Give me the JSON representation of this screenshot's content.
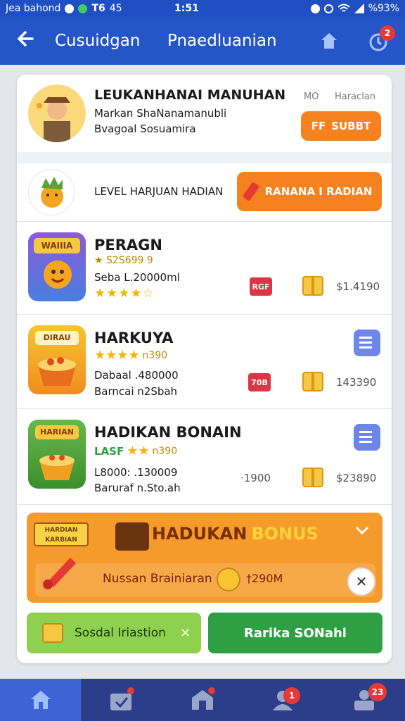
{
  "status_bar": {
    "left_text": "Jea bahond",
    "app_code": "T6",
    "extra": "45",
    "time": "1:51",
    "battery": "%93%"
  },
  "app_bar": {
    "title": "Cusuidgan",
    "subtitle": "Pnaedluanian",
    "notification_count": "2"
  },
  "profile": {
    "name": "LEUKANHANAI MANUHAN",
    "line1": "Markan ShaNanamanubli",
    "line2": "Bvagoal Sosuamira",
    "meta1": "MO",
    "meta2": "Haraclan",
    "button_prefix": "FF",
    "button_label": "SUBBT"
  },
  "level": {
    "label": "LEVEL HARJUAN HADIAN",
    "button_label": "RANANA I RADIAN"
  },
  "games": [
    {
      "title": "PERAGN",
      "thumb_label": "WAIIIA",
      "rating_text": "S2S699 9",
      "sub": "Seba L.20000ml",
      "tag": "RGF",
      "price": "$1.4190",
      "stars": "★★★★☆"
    },
    {
      "title": "HARKUYA",
      "thumb_label": "DIRAU",
      "rating_text": "n390",
      "sub1": "Dabaal .480000",
      "sub2": "Barncai n2Sbah",
      "tag": "70B",
      "price": "143390",
      "stars": "★★★★"
    },
    {
      "title": "HADIKAN BONAIN",
      "thumb_label": "HARIAN",
      "rating_text": "LASF",
      "rating_num": "n390",
      "sub1": "L8000: .130009",
      "sub2": "Baruraf n.Sto.ah",
      "mid_value": "·1900",
      "price": "$23890",
      "stars": "★★"
    }
  ],
  "bonus": {
    "badge_text": "HARDIAN KARBIAN",
    "title_part1": "HADUKAN",
    "title_part2": "BONUS",
    "message": "Nussan Brainiaran",
    "amount": "†290M",
    "close": "✕"
  },
  "actions": {
    "social_label": "Sosdal Iriastion",
    "social_close": "✕",
    "green_button": "Rarika SONahl"
  },
  "bottom_nav": {
    "badges": [
      "",
      "",
      "",
      "1",
      "23"
    ]
  },
  "colors": {
    "primary": "#2456c8",
    "orange": "#f5821f",
    "green": "#2ea043",
    "light_green": "#8fd14f",
    "red": "#dc3545"
  }
}
